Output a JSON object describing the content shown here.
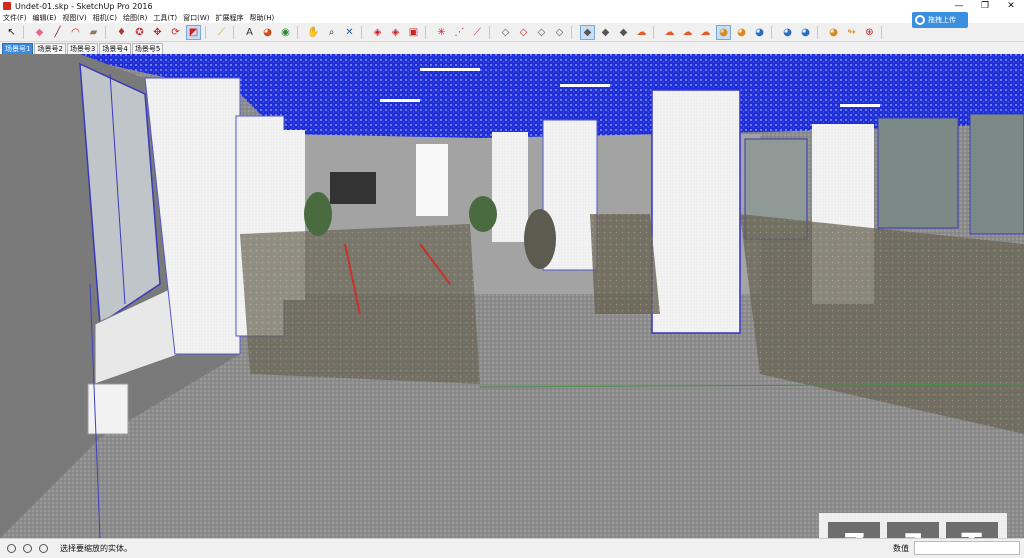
{
  "window": {
    "title": "Undet-01.skp - SketchUp Pro 2016",
    "controls": [
      "—",
      "❐",
      "✕"
    ]
  },
  "menu": [
    "文件(F)",
    "编辑(E)",
    "视图(V)",
    "相机(C)",
    "绘图(R)",
    "工具(T)",
    "窗口(W)",
    "扩展程序",
    "帮助(H)"
  ],
  "toolbar": {
    "buttons": [
      {
        "name": "select-tool-icon",
        "glyph": "↖",
        "color": "#222222"
      },
      {
        "name": "eraser-tool-icon",
        "glyph": "◆",
        "color": "#e26a8b"
      },
      {
        "name": "line-tool-icon",
        "glyph": "╱",
        "color": "#8a1d1d"
      },
      {
        "name": "arc-tool-icon",
        "glyph": "◠",
        "color": "#c23030"
      },
      {
        "name": "shapes-tool-icon",
        "glyph": "▰",
        "color": "#8f7a5a"
      },
      {
        "name": "push-pull-tool-icon",
        "glyph": "♦",
        "color": "#b03a2e"
      },
      {
        "name": "follow-me-tool-icon",
        "glyph": "✪",
        "color": "#cc3333"
      },
      {
        "name": "move-tool-icon",
        "glyph": "✥",
        "color": "#cc2222"
      },
      {
        "name": "rotate-tool-icon",
        "glyph": "⟳",
        "color": "#cc2222"
      },
      {
        "name": "scale-tool-icon",
        "glyph": "◩",
        "color": "#cc2222",
        "active": true
      },
      {
        "name": "tape-measure-tool-icon",
        "glyph": "⟋",
        "color": "#c9a227"
      },
      {
        "name": "text-tool-icon",
        "glyph": "A",
        "color": "#333333"
      },
      {
        "name": "paint-bucket-tool-icon",
        "glyph": "◕",
        "color": "#d14a1a"
      },
      {
        "name": "orbit-tool-icon",
        "glyph": "◉",
        "color": "#2e8b2e"
      },
      {
        "name": "pan-tool-icon",
        "glyph": "✋",
        "color": "#c9a227"
      },
      {
        "name": "zoom-tool-icon",
        "glyph": "⌕",
        "color": "#333333"
      },
      {
        "name": "zoom-extents-tool-icon",
        "glyph": "✕",
        "color": "#2b5fad"
      },
      {
        "name": "warehouse-tool-icon",
        "glyph": "◈",
        "color": "#cc2222"
      },
      {
        "name": "share-model-tool-icon",
        "glyph": "◈",
        "color": "#cc2222"
      },
      {
        "name": "extension-warehouse-tool-icon",
        "glyph": "▣",
        "color": "#cc2222"
      },
      {
        "name": "axes-tool-icon",
        "glyph": "✳",
        "color": "#cc2222"
      },
      {
        "name": "dimension-tool-icon",
        "glyph": "⋰",
        "color": "#cc2222"
      },
      {
        "name": "section-plane-tool-icon",
        "glyph": "⟋",
        "color": "#cc2222"
      },
      {
        "name": "style-xray-icon",
        "glyph": "◇",
        "color": "#555555"
      },
      {
        "name": "style-wireframe-icon",
        "glyph": "◇",
        "color": "#cc2222"
      },
      {
        "name": "style-hidden-line-icon",
        "glyph": "◇",
        "color": "#555555"
      },
      {
        "name": "style-shaded-icon",
        "glyph": "◇",
        "color": "#555555"
      },
      {
        "name": "style-textured-icon",
        "glyph": "◆",
        "color": "#555555",
        "active": true
      },
      {
        "name": "style-monochrome-icon",
        "glyph": "◆",
        "color": "#555555"
      },
      {
        "name": "style-back-edges-icon",
        "glyph": "◆",
        "color": "#555555"
      },
      {
        "name": "cloud-sync-icon",
        "glyph": "☁",
        "color": "#e65a2a"
      },
      {
        "name": "cloud-upload-icon",
        "glyph": "☁",
        "color": "#e65a2a"
      },
      {
        "name": "cloud-download-icon",
        "glyph": "☁",
        "color": "#e65a2a"
      },
      {
        "name": "cloud-settings-icon",
        "glyph": "☁",
        "color": "#e65a2a"
      },
      {
        "name": "sandbox-from-contours-icon",
        "glyph": "◕",
        "color": "#d88a1a",
        "active": true
      },
      {
        "name": "sandbox-from-scratch-icon",
        "glyph": "◕",
        "color": "#d88a1a"
      },
      {
        "name": "sandbox-smoove-icon",
        "glyph": "◕",
        "color": "#2a6fbf"
      },
      {
        "name": "sandbox-stamp-icon",
        "glyph": "◕",
        "color": "#2a6fbf"
      },
      {
        "name": "sandbox-drape-icon",
        "glyph": "◕",
        "color": "#2a6fbf"
      },
      {
        "name": "sandbox-add-detail-icon",
        "glyph": "◕",
        "color": "#d88a1a"
      },
      {
        "name": "flip-edge-icon",
        "glyph": "↬",
        "color": "#d88a1a"
      },
      {
        "name": "add-location-icon",
        "glyph": "⊕",
        "color": "#cc2222"
      },
      {
        "name": "toggle-terrain-icon",
        "glyph": "⊗",
        "color": "#cc2222"
      },
      {
        "name": "photo-texture-icon",
        "glyph": "✥",
        "color": "#777777"
      },
      {
        "name": "reload-icon",
        "glyph": "⟳",
        "color": "#777777"
      },
      {
        "name": "undo-arrow-icon",
        "glyph": "⤺",
        "color": "#777777"
      }
    ],
    "upload_label": "拖拽上传"
  },
  "scenes": [
    "场景号1",
    "场景号2",
    "场景号3",
    "场景号4",
    "场景号5"
  ],
  "active_scene": 0,
  "viewport": {
    "description_colors": {
      "ceiling": "#1e2bd6",
      "floor": "#8a8a8a",
      "pillar": "#f4f4f4"
    }
  },
  "watermark": {
    "letters": [
      "Z",
      "∃",
      "T"
    ]
  },
  "status": {
    "message": "选择要缩放的实体。",
    "measurements_label": "数值",
    "measurements_value": ""
  }
}
